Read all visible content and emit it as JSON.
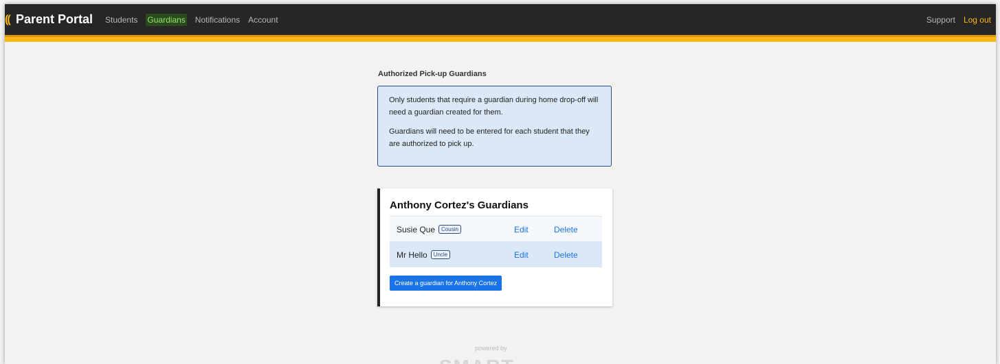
{
  "header": {
    "brand_mark": "((",
    "brand_name": "Parent Portal",
    "nav": [
      {
        "label": "Students"
      },
      {
        "label": "Guardians",
        "active": true
      },
      {
        "label": "Notifications"
      },
      {
        "label": "Account"
      }
    ],
    "support_label": "Support",
    "logout_label": "Log out",
    "accent_color": "#fbb811"
  },
  "main": {
    "section_title": "Authorized Pick-up Guardians",
    "info_paragraphs": [
      "Only students that require a guardian during home drop-off will need a guardian created for them.",
      "Guardians will need to be entered for each student that they are authorized to pick up."
    ],
    "student_card": {
      "title": "Anthony Cortez's Guardians",
      "guardians": [
        {
          "name": "Susie Que",
          "relation": "Cousin",
          "edit_label": "Edit",
          "delete_label": "Delete"
        },
        {
          "name": "Mr Hello",
          "relation": "Uncle",
          "edit_label": "Edit",
          "delete_label": "Delete"
        }
      ],
      "create_button_label": "Create a guardian for Anthony Cortez"
    }
  },
  "footer": {
    "powered_by": "powered by",
    "logo_text": "SMART"
  }
}
